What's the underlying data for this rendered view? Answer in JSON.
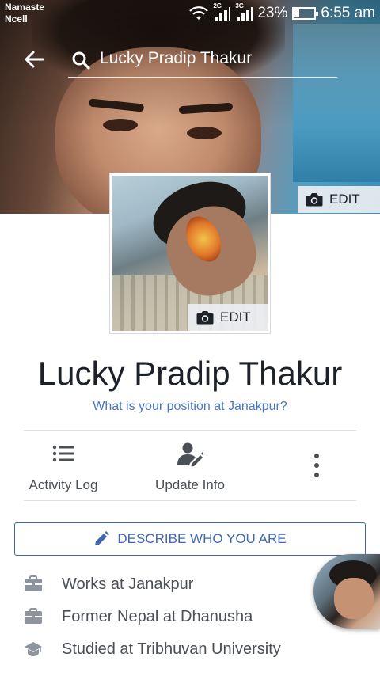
{
  "status_bar": {
    "carrier_line1": "Namaste",
    "carrier_line2": "Ncell",
    "net1": "2G",
    "net2": "3G",
    "battery": "23%",
    "battery_level": 0.23,
    "time": "6:55 am"
  },
  "search": {
    "query": "Lucky Pradip Thakur"
  },
  "cover": {
    "edit_label": "EDIT"
  },
  "avatar": {
    "edit_label": "EDIT"
  },
  "profile": {
    "name": "Lucky Pradip Thakur",
    "position_prompt": "What is your position at Janakpur?"
  },
  "actions": {
    "activity_log": "Activity Log",
    "update_info": "Update Info"
  },
  "describe_button": "DESCRIBE WHO YOU ARE",
  "intro": [
    {
      "icon": "briefcase-icon",
      "text": "Works at Janakpur"
    },
    {
      "icon": "briefcase-icon",
      "text": "Former Nepal at Dhanusha"
    },
    {
      "icon": "graduation-cap-icon",
      "text": "Studied at Tribhuvan University"
    }
  ],
  "colors": {
    "accent": "#4267b2",
    "link": "#4a76c4",
    "text": "#1d2129",
    "secondary_text": "#4b4f56"
  }
}
